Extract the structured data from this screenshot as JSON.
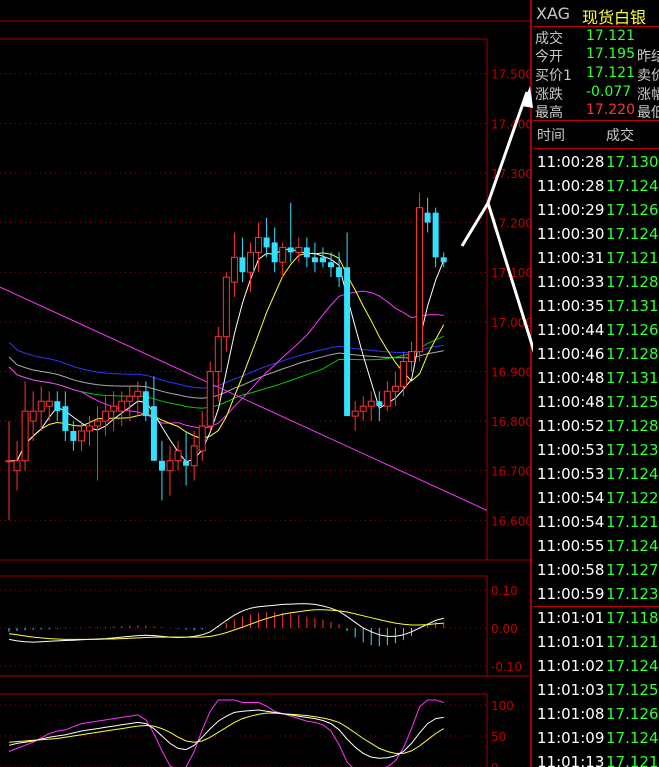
{
  "colors": {
    "up": "#ff3333",
    "down": "#33e0ff",
    "frame": "#a00000",
    "ma5": "#ffffff",
    "ma10": "#ffff33",
    "ma20": "#ff33ff",
    "ma40": "#00cc00",
    "ma60": "#aaaaaa",
    "ma120": "#3333ff",
    "trendline": "#ff33ff",
    "arrow": "#ffffff"
  },
  "quote": {
    "symbol": "XAG",
    "name": "现货白银",
    "rows": [
      {
        "label": "成交",
        "value": "17.121",
        "label2": ""
      },
      {
        "label": "今开",
        "value": "17.195",
        "label2": "昨结"
      },
      {
        "label": "买价1",
        "value": "17.121",
        "label2": "卖价"
      },
      {
        "label": "涨跌",
        "value": "-0.077",
        "label2": "涨幅"
      },
      {
        "label": "最高",
        "value": "17.220",
        "label2": "最低"
      }
    ]
  },
  "ticks": {
    "header": {
      "time": "时间",
      "price": "成交"
    },
    "rows": [
      {
        "time": "11:00:28",
        "price": "17.130"
      },
      {
        "time": "11:00:28",
        "price": "17.124"
      },
      {
        "time": "11:00:29",
        "price": "17.126"
      },
      {
        "time": "11:00:30",
        "price": "17.124"
      },
      {
        "time": "11:00:31",
        "price": "17.121"
      },
      {
        "time": "11:00:33",
        "price": "17.128"
      },
      {
        "time": "11:00:35",
        "price": "17.131"
      },
      {
        "time": "11:00:44",
        "price": "17.126"
      },
      {
        "time": "11:00:46",
        "price": "17.128"
      },
      {
        "time": "11:00:48",
        "price": "17.131"
      },
      {
        "time": "11:00:48",
        "price": "17.125"
      },
      {
        "time": "11:00:52",
        "price": "17.128"
      },
      {
        "time": "11:00:53",
        "price": "17.123"
      },
      {
        "time": "11:00:53",
        "price": "17.124"
      },
      {
        "time": "11:00:54",
        "price": "17.122"
      },
      {
        "time": "11:00:54",
        "price": "17.121"
      },
      {
        "time": "11:00:55",
        "price": "17.124"
      },
      {
        "time": "11:00:58",
        "price": "17.127"
      },
      {
        "time": "11:00:59",
        "price": "17.123"
      },
      {
        "time": "11:01:01",
        "price": "17.118"
      },
      {
        "time": "11:01:01",
        "price": "17.121"
      },
      {
        "time": "11:01:02",
        "price": "17.124"
      },
      {
        "time": "11:01:03",
        "price": "17.125"
      },
      {
        "time": "11:01:08",
        "price": "17.126"
      },
      {
        "time": "11:01:09",
        "price": "17.124"
      },
      {
        "time": "11:01:13",
        "price": "17.121"
      }
    ]
  },
  "chart_data": [
    {
      "type": "candlestick",
      "ylim": [
        16.52,
        17.57
      ],
      "yticks": [
        "17.500",
        "17.400",
        "17.300",
        "17.200",
        "17.100",
        "17.000",
        "16.900",
        "16.800",
        "16.700",
        "16.600"
      ],
      "candles": [
        {
          "o": 16.72,
          "h": 16.8,
          "l": 16.6,
          "c": 16.72
        },
        {
          "o": 16.7,
          "h": 16.76,
          "l": 16.66,
          "c": 16.72
        },
        {
          "o": 16.72,
          "h": 16.88,
          "l": 16.7,
          "c": 16.82
        },
        {
          "o": 16.8,
          "h": 16.86,
          "l": 16.76,
          "c": 16.82
        },
        {
          "o": 16.82,
          "h": 16.87,
          "l": 16.78,
          "c": 16.84
        },
        {
          "o": 16.83,
          "h": 16.86,
          "l": 16.8,
          "c": 16.84
        },
        {
          "o": 16.84,
          "h": 16.86,
          "l": 16.8,
          "c": 16.82
        },
        {
          "o": 16.83,
          "h": 16.86,
          "l": 16.76,
          "c": 16.78
        },
        {
          "o": 16.78,
          "h": 16.8,
          "l": 16.74,
          "c": 16.76
        },
        {
          "o": 16.76,
          "h": 16.8,
          "l": 16.74,
          "c": 16.78
        },
        {
          "o": 16.78,
          "h": 16.81,
          "l": 16.75,
          "c": 16.79
        },
        {
          "o": 16.79,
          "h": 16.83,
          "l": 16.68,
          "c": 16.8
        },
        {
          "o": 16.8,
          "h": 16.85,
          "l": 16.77,
          "c": 16.82
        },
        {
          "o": 16.82,
          "h": 16.86,
          "l": 16.78,
          "c": 16.83
        },
        {
          "o": 16.82,
          "h": 16.86,
          "l": 16.79,
          "c": 16.84
        },
        {
          "o": 16.84,
          "h": 16.87,
          "l": 16.8,
          "c": 16.85
        },
        {
          "o": 16.85,
          "h": 16.88,
          "l": 16.81,
          "c": 16.86
        },
        {
          "o": 16.86,
          "h": 16.88,
          "l": 16.8,
          "c": 16.81
        },
        {
          "o": 16.83,
          "h": 16.89,
          "l": 16.72,
          "c": 16.72
        },
        {
          "o": 16.72,
          "h": 16.76,
          "l": 16.64,
          "c": 16.7
        },
        {
          "o": 16.7,
          "h": 16.75,
          "l": 16.65,
          "c": 16.72
        },
        {
          "o": 16.72,
          "h": 16.76,
          "l": 16.7,
          "c": 16.74
        },
        {
          "o": 16.72,
          "h": 16.78,
          "l": 16.67,
          "c": 16.71
        },
        {
          "o": 16.71,
          "h": 16.78,
          "l": 16.68,
          "c": 16.75
        },
        {
          "o": 16.74,
          "h": 16.82,
          "l": 16.72,
          "c": 16.79
        },
        {
          "o": 16.79,
          "h": 16.92,
          "l": 16.78,
          "c": 16.9
        },
        {
          "o": 16.9,
          "h": 16.99,
          "l": 16.84,
          "c": 16.97
        },
        {
          "o": 16.97,
          "h": 17.1,
          "l": 16.94,
          "c": 17.09
        },
        {
          "o": 17.08,
          "h": 17.18,
          "l": 17.05,
          "c": 17.13
        },
        {
          "o": 17.13,
          "h": 17.17,
          "l": 17.08,
          "c": 17.1
        },
        {
          "o": 17.1,
          "h": 17.16,
          "l": 17.06,
          "c": 17.14
        },
        {
          "o": 17.14,
          "h": 17.2,
          "l": 17.1,
          "c": 17.17
        },
        {
          "o": 17.17,
          "h": 17.21,
          "l": 17.13,
          "c": 17.15
        },
        {
          "o": 17.16,
          "h": 17.19,
          "l": 17.1,
          "c": 17.12
        },
        {
          "o": 17.12,
          "h": 17.16,
          "l": 17.09,
          "c": 17.15
        },
        {
          "o": 17.15,
          "h": 17.24,
          "l": 17.12,
          "c": 17.14
        },
        {
          "o": 17.14,
          "h": 17.17,
          "l": 17.12,
          "c": 17.15
        },
        {
          "o": 17.15,
          "h": 17.17,
          "l": 17.11,
          "c": 17.13
        },
        {
          "o": 17.13,
          "h": 17.16,
          "l": 17.1,
          "c": 17.12
        },
        {
          "o": 17.13,
          "h": 17.15,
          "l": 17.11,
          "c": 17.12
        },
        {
          "o": 17.12,
          "h": 17.14,
          "l": 17.09,
          "c": 17.11
        },
        {
          "o": 17.11,
          "h": 17.14,
          "l": 17.07,
          "c": 17.09
        },
        {
          "o": 17.11,
          "h": 17.18,
          "l": 16.9,
          "c": 16.81
        },
        {
          "o": 16.81,
          "h": 16.84,
          "l": 16.78,
          "c": 16.82
        },
        {
          "o": 16.82,
          "h": 16.85,
          "l": 16.8,
          "c": 16.83
        },
        {
          "o": 16.83,
          "h": 16.86,
          "l": 16.8,
          "c": 16.84
        },
        {
          "o": 16.84,
          "h": 16.86,
          "l": 16.8,
          "c": 16.83
        },
        {
          "o": 16.83,
          "h": 16.88,
          "l": 16.82,
          "c": 16.86
        },
        {
          "o": 16.86,
          "h": 16.9,
          "l": 16.83,
          "c": 16.87
        },
        {
          "o": 16.87,
          "h": 16.94,
          "l": 16.85,
          "c": 16.92
        },
        {
          "o": 16.92,
          "h": 16.96,
          "l": 16.9,
          "c": 16.94
        },
        {
          "o": 16.94,
          "h": 17.26,
          "l": 16.92,
          "c": 17.23
        },
        {
          "o": 17.22,
          "h": 17.25,
          "l": 17.18,
          "c": 17.2
        },
        {
          "o": 17.22,
          "h": 17.23,
          "l": 17.11,
          "c": 17.13
        },
        {
          "o": 17.13,
          "h": 17.14,
          "l": 17.11,
          "c": 17.12
        }
      ]
    },
    {
      "type": "macd",
      "ylim": [
        -0.1,
        0.1
      ],
      "yticks": [
        "0.10",
        "0.00",
        "-0.10"
      ],
      "histogram": [
        -0.01,
        -0.008,
        -0.006,
        -0.005,
        -0.004,
        -0.003,
        -0.002,
        -0.001,
        0.0,
        0.001,
        0.002,
        0.002,
        0.003,
        0.004,
        0.005,
        0.006,
        0.007,
        0.006,
        0.004,
        0.002,
        0.0,
        -0.002,
        -0.004,
        -0.006,
        -0.004,
        0.0,
        0.006,
        0.014,
        0.022,
        0.03,
        0.036,
        0.04,
        0.042,
        0.042,
        0.04,
        0.038,
        0.035,
        0.03,
        0.026,
        0.022,
        0.016,
        0.01,
        -0.008,
        -0.025,
        -0.038,
        -0.045,
        -0.048,
        -0.045,
        -0.04,
        -0.032,
        -0.02,
        0.0,
        0.01,
        0.016,
        0.014
      ],
      "dif": [
        -0.03,
        -0.034,
        -0.036,
        -0.037,
        -0.036,
        -0.035,
        -0.034,
        -0.033,
        -0.032,
        -0.031,
        -0.03,
        -0.029,
        -0.028,
        -0.026,
        -0.024,
        -0.022,
        -0.02,
        -0.019,
        -0.02,
        -0.022,
        -0.024,
        -0.025,
        -0.024,
        -0.022,
        -0.018,
        -0.01,
        0.005,
        0.02,
        0.034,
        0.045,
        0.052,
        0.056,
        0.058,
        0.06,
        0.062,
        0.063,
        0.064,
        0.064,
        0.062,
        0.058,
        0.052,
        0.044,
        0.03,
        0.015,
        0.0,
        -0.01,
        -0.018,
        -0.022,
        -0.022,
        -0.018,
        -0.01,
        0.0,
        0.01,
        0.02,
        0.026
      ],
      "dea": [
        -0.015,
        -0.018,
        -0.021,
        -0.024,
        -0.026,
        -0.028,
        -0.029,
        -0.03,
        -0.03,
        -0.03,
        -0.03,
        -0.03,
        -0.029,
        -0.029,
        -0.028,
        -0.027,
        -0.026,
        -0.025,
        -0.024,
        -0.024,
        -0.024,
        -0.024,
        -0.024,
        -0.024,
        -0.024,
        -0.022,
        -0.018,
        -0.012,
        -0.005,
        0.002,
        0.01,
        0.018,
        0.025,
        0.031,
        0.036,
        0.04,
        0.043,
        0.046,
        0.048,
        0.048,
        0.047,
        0.045,
        0.042,
        0.037,
        0.032,
        0.027,
        0.022,
        0.017,
        0.013,
        0.01,
        0.008,
        0.008,
        0.009,
        0.011,
        0.013
      ]
    },
    {
      "type": "kdj",
      "ylim": [
        0,
        110
      ],
      "yticks": [
        "100",
        "50",
        "0"
      ],
      "k": [
        35,
        38,
        40,
        42,
        45,
        48,
        50,
        52,
        55,
        58,
        60,
        62,
        64,
        66,
        68,
        70,
        72,
        70,
        62,
        50,
        38,
        30,
        28,
        35,
        48,
        62,
        74,
        82,
        88,
        90,
        91,
        92,
        90,
        88,
        86,
        84,
        82,
        80,
        78,
        75,
        70,
        60,
        45,
        32,
        22,
        16,
        14,
        15,
        18,
        25,
        38,
        55,
        70,
        78,
        80
      ],
      "d": [
        40,
        41,
        42,
        43,
        44,
        45,
        46,
        48,
        50,
        52,
        54,
        56,
        58,
        60,
        62,
        64,
        66,
        67,
        66,
        62,
        56,
        48,
        42,
        40,
        42,
        48,
        56,
        64,
        72,
        78,
        82,
        85,
        87,
        87,
        86,
        85,
        84,
        83,
        81,
        79,
        76,
        72,
        64,
        55,
        46,
        38,
        30,
        25,
        22,
        22,
        26,
        34,
        44,
        54,
        62
      ],
      "j": [
        25,
        30,
        35,
        40,
        47,
        54,
        58,
        60,
        65,
        70,
        72,
        74,
        76,
        78,
        80,
        82,
        84,
        76,
        54,
        26,
        2,
        -5,
        0,
        25,
        60,
        90,
        108,
        110,
        108,
        104,
        104,
        104,
        98,
        90,
        86,
        82,
        78,
        74,
        72,
        68,
        58,
        36,
        8,
        -5,
        -6,
        -4,
        -2,
        0,
        10,
        31,
        62,
        97,
        110,
        108,
        104
      ]
    }
  ]
}
